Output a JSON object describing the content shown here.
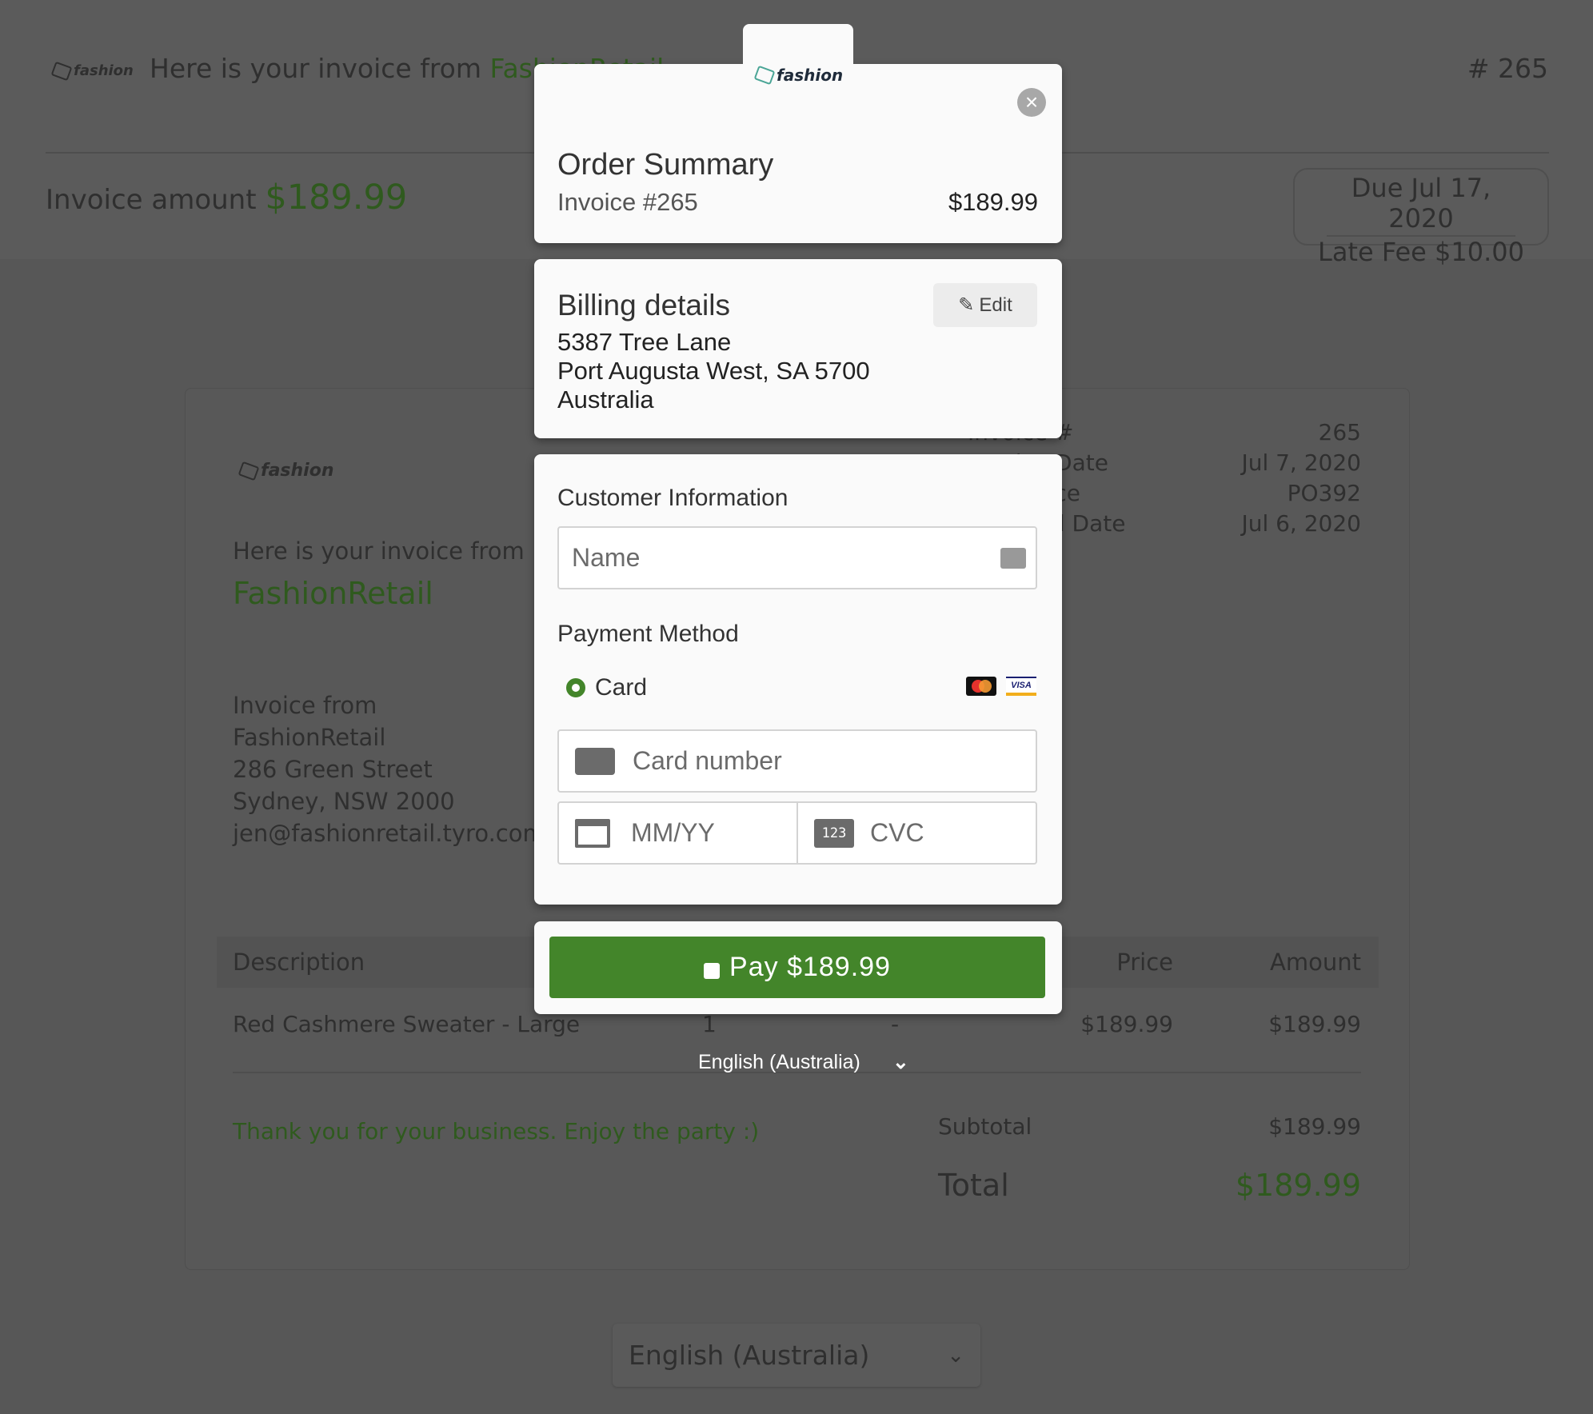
{
  "header": {
    "logo": "fashion",
    "intro": "Here is your invoice from ",
    "merchant": "FashionRetail",
    "invoice_no": "# 265",
    "amount_label": "Invoice amount ",
    "amount": "$189.99",
    "due_label": "Due ",
    "due_date": "Jul 17, 2020",
    "late_fee_label": "Late Fee ",
    "late_fee": "$10.00"
  },
  "invoice": {
    "logo": "fashion",
    "intro": "Here is your invoice from",
    "merchant": "FashionRetail",
    "from_label": "Invoice from",
    "from_lines": [
      "FashionRetail",
      "286 Green Street",
      "Sydney, NSW 2000",
      "jen@fashionretail.tyro.com"
    ],
    "meta": [
      {
        "label": "Invoice #",
        "value": "265"
      },
      {
        "label": "Invoice Date",
        "value": "Jul 7, 2020"
      },
      {
        "label": "Reference",
        "value": "PO392"
      },
      {
        "label": "Supplied Date",
        "value": "Jul 6, 2020"
      }
    ],
    "columns": {
      "description": "Description",
      "price": "Price",
      "amount": "Amount"
    },
    "rows": [
      {
        "description": "Red Cashmere Sweater - Large",
        "qty": "1",
        "discount": "-",
        "price": "$189.99",
        "amount": "$189.99"
      }
    ],
    "note": "Thank you for your business. Enjoy the party :)",
    "subtotal_label": "Subtotal",
    "subtotal": "$189.99",
    "total_label": "Total",
    "total": "$189.99"
  },
  "language": {
    "selected": "English (Australia)"
  },
  "modal": {
    "logo": "fashion",
    "order": {
      "title": "Order Summary",
      "invoice": "Invoice #265",
      "amount": "$189.99"
    },
    "billing": {
      "title": "Billing details",
      "edit": "Edit",
      "lines": [
        "5387 Tree Lane",
        "Port Augusta West, SA 5700",
        "Australia"
      ]
    },
    "customer": {
      "title": "Customer Information",
      "name_placeholder": "Name",
      "payment_title": "Payment Method",
      "method": "Card",
      "card_placeholder": "Card number",
      "exp_placeholder": "MM/YY",
      "cvc_placeholder": "CVC",
      "cvc_icon": "123",
      "brands": [
        "mastercard",
        "VISA"
      ]
    },
    "pay": "Pay $189.99",
    "language": "English (Australia)",
    "accent": "#43852a"
  }
}
